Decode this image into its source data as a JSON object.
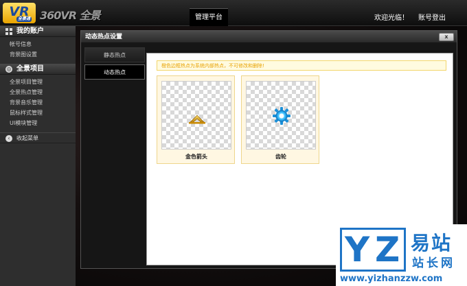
{
  "header": {
    "logo_badge": "VR",
    "logo_badge_sub": "全景通",
    "logo_text": "360VR 全景通",
    "nav_platform": "管理平台",
    "welcome": "欢迎光临！",
    "logout": "账号登出"
  },
  "sidebar": {
    "account": {
      "title": "我的账户",
      "items": [
        "帐号信息",
        "背景图设置"
      ]
    },
    "project": {
      "title": "全景项目",
      "items": [
        "全景项目管理",
        "全景热点管理",
        "背景音乐管理",
        "鼠标样式管理",
        "UI模块管理"
      ]
    },
    "collapse": "收起菜单"
  },
  "dialog": {
    "title": "动态热点设置",
    "close": "x",
    "tabs": [
      {
        "label": "静态热点",
        "active": false
      },
      {
        "label": "动态热点",
        "active": true
      }
    ],
    "warning": "橙色边框热点为系统内部热点，不可修改和删除!",
    "items": [
      {
        "label": "金色箭头",
        "icon": "gold-arrow-icon"
      },
      {
        "label": "齿轮",
        "icon": "gear-icon"
      }
    ]
  },
  "watermark": {
    "letters_1": "Y",
    "letters_2": "Z",
    "title": "易站",
    "subtitle": "站长网",
    "url": "www.yizhanzzw.com"
  },
  "colors": {
    "warning_text": "#e8a200",
    "card_border": "#eed58a",
    "watermark_blue": "#1e74c6"
  }
}
